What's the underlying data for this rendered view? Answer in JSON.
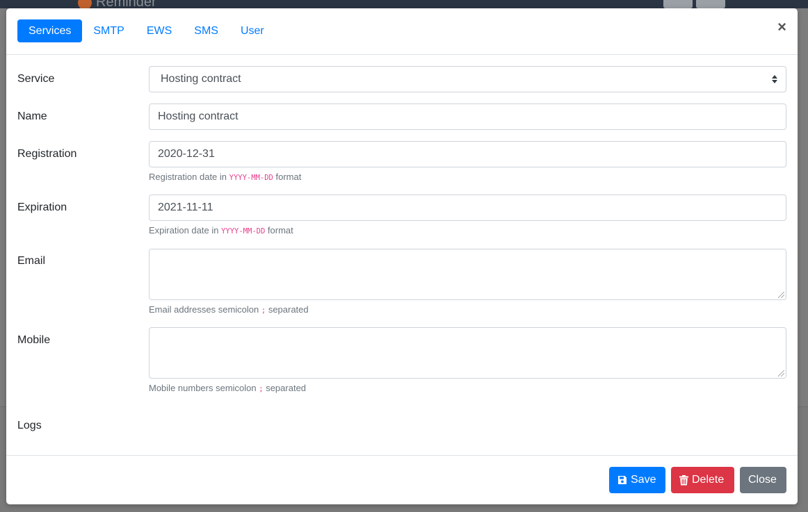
{
  "app": {
    "brand": "Reminder"
  },
  "tabs": [
    {
      "label": "Services",
      "active": true
    },
    {
      "label": "SMTP",
      "active": false
    },
    {
      "label": "EWS",
      "active": false
    },
    {
      "label": "SMS",
      "active": false
    },
    {
      "label": "User",
      "active": false
    }
  ],
  "close_glyph": "×",
  "form": {
    "service": {
      "label": "Service",
      "value": "Hosting contract"
    },
    "name": {
      "label": "Name",
      "value": "Hosting contract"
    },
    "registration": {
      "label": "Registration",
      "value": "2020-12-31",
      "help_pre": "Registration date in",
      "help_code": "YYYY-MM-DD",
      "help_post": "format"
    },
    "expiration": {
      "label": "Expiration",
      "value": "2021-11-11",
      "help_pre": "Expiration date in",
      "help_code": "YYYY-MM-DD",
      "help_post": "format"
    },
    "email": {
      "label": "Email",
      "value": "",
      "help_pre": "Email addresses semicolon",
      "help_code": ";",
      "help_post": "separated"
    },
    "mobile": {
      "label": "Mobile",
      "value": "",
      "help_pre": "Mobile numbers semicolon",
      "help_code": ";",
      "help_post": "separated"
    },
    "logs": {
      "label": "Logs"
    }
  },
  "footer": {
    "save_label": "Save",
    "delete_label": "Delete",
    "close_label": "Close"
  },
  "colors": {
    "primary": "#007bff",
    "danger": "#dc3545",
    "secondary": "#6c757d",
    "code": "#e83e8c"
  },
  "icons": [
    "floppy-disk-icon",
    "trash-icon",
    "close-icon",
    "select-caret-icon"
  ]
}
